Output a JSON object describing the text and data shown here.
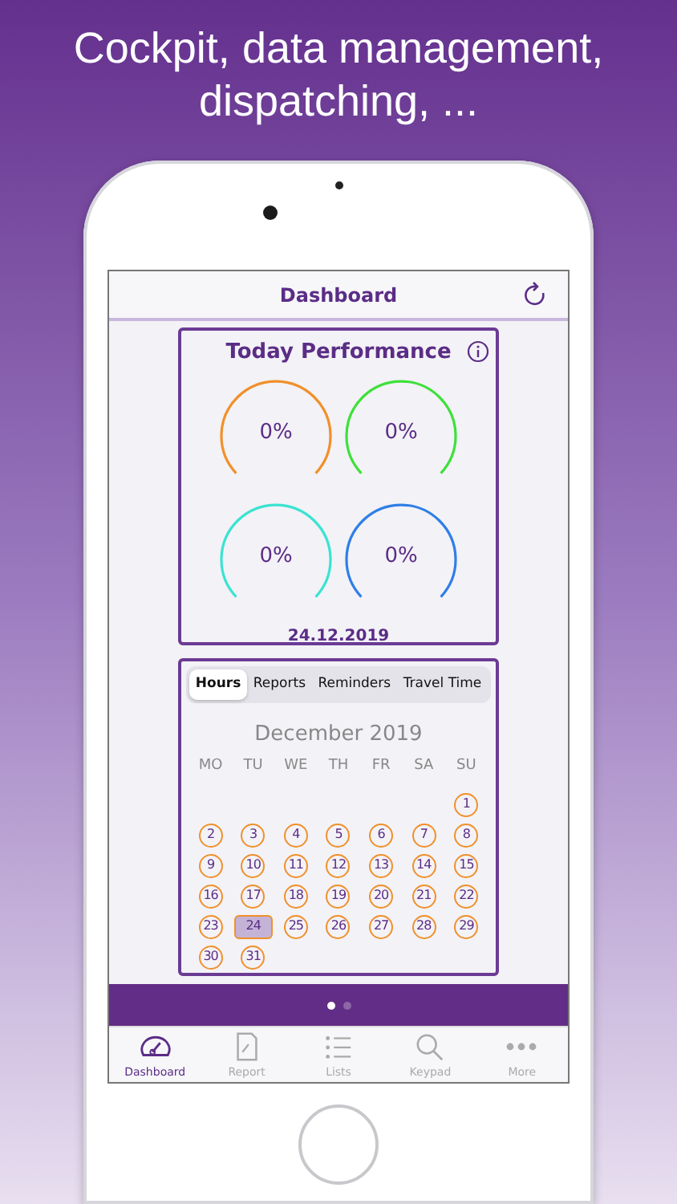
{
  "headline": "Cockpit, data management, dispatching, ...",
  "header": {
    "title": "Dashboard"
  },
  "performance": {
    "title": "Today Performance",
    "date": "24.12.2019",
    "gauges": [
      {
        "value": "0%",
        "color": "#f0902a"
      },
      {
        "value": "0%",
        "color": "#3ee03a"
      },
      {
        "value": "0%",
        "color": "#3ae3d2"
      },
      {
        "value": "0%",
        "color": "#2f7fe6"
      }
    ]
  },
  "calendar": {
    "tabs": [
      {
        "label": "Hours",
        "selected": true
      },
      {
        "label": "Reports",
        "selected": false
      },
      {
        "label": "Reminders",
        "selected": false
      },
      {
        "label": "Travel Time",
        "selected": false
      }
    ],
    "month": "December 2019",
    "weekdays": [
      "MO",
      "TU",
      "WE",
      "TH",
      "FR",
      "SA",
      "SU"
    ],
    "weeks": [
      {
        "days": [
          {
            "day": "1",
            "marked": true,
            "selected": false
          }
        ]
      },
      {
        "days": [
          {
            "day": "2",
            "marked": true,
            "selected": false
          },
          {
            "day": "3",
            "marked": true,
            "selected": false
          },
          {
            "day": "4",
            "marked": true,
            "selected": false
          },
          {
            "day": "5",
            "marked": true,
            "selected": false
          },
          {
            "day": "6",
            "marked": true,
            "selected": false
          },
          {
            "day": "7",
            "marked": true,
            "selected": false
          },
          {
            "day": "8",
            "marked": true,
            "selected": false
          }
        ]
      },
      {
        "days": [
          {
            "day": "9",
            "marked": true,
            "selected": false
          },
          {
            "day": "10",
            "marked": true,
            "selected": false
          },
          {
            "day": "11",
            "marked": true,
            "selected": false
          },
          {
            "day": "12",
            "marked": true,
            "selected": false
          },
          {
            "day": "13",
            "marked": true,
            "selected": false
          },
          {
            "day": "14",
            "marked": true,
            "selected": false
          },
          {
            "day": "15",
            "marked": true,
            "selected": false
          }
        ]
      },
      {
        "days": [
          {
            "day": "16",
            "marked": true,
            "selected": false
          },
          {
            "day": "17",
            "marked": true,
            "selected": false
          },
          {
            "day": "18",
            "marked": true,
            "selected": false
          },
          {
            "day": "19",
            "marked": true,
            "selected": false
          },
          {
            "day": "20",
            "marked": true,
            "selected": false
          },
          {
            "day": "21",
            "marked": true,
            "selected": false
          },
          {
            "day": "22",
            "marked": true,
            "selected": false
          }
        ]
      },
      {
        "days": [
          {
            "day": "23",
            "marked": true,
            "selected": false
          },
          {
            "day": "24",
            "marked": true,
            "selected": true
          },
          {
            "day": "25",
            "marked": true,
            "selected": false
          },
          {
            "day": "26",
            "marked": true,
            "selected": false
          },
          {
            "day": "27",
            "marked": true,
            "selected": false
          },
          {
            "day": "28",
            "marked": true,
            "selected": false
          },
          {
            "day": "29",
            "marked": true,
            "selected": false
          }
        ]
      },
      {
        "days": [
          {
            "day": "30",
            "marked": true,
            "selected": false
          },
          {
            "day": "31",
            "marked": true,
            "selected": false
          }
        ]
      }
    ]
  },
  "page_dots": [
    {
      "selected": true
    },
    {
      "selected": false
    }
  ],
  "tab_bar": [
    {
      "label": "Dashboard",
      "kind": "gauge",
      "selected": true
    },
    {
      "label": "Report",
      "kind": "document",
      "selected": false
    },
    {
      "label": "Lists",
      "kind": "list",
      "selected": false
    },
    {
      "label": "Keypad",
      "kind": "search",
      "selected": false
    },
    {
      "label": "More",
      "kind": "more",
      "selected": false
    }
  ]
}
